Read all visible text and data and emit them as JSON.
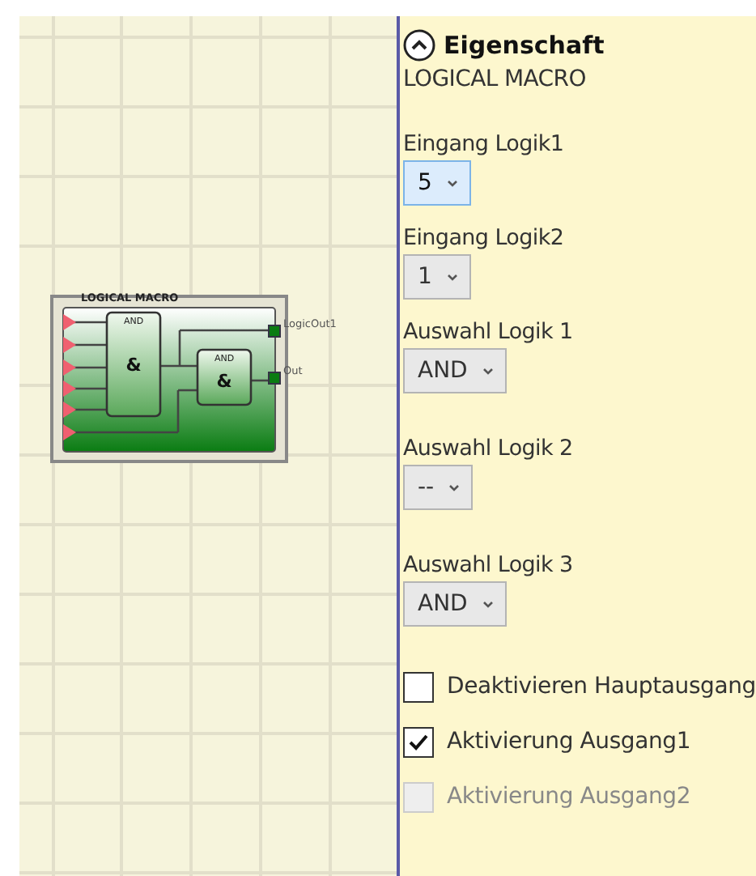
{
  "diagram": {
    "block": {
      "title": "LOGICAL MACRO",
      "gates": [
        {
          "label": "AND",
          "symbol": "&"
        },
        {
          "label": "AND",
          "symbol": "&"
        }
      ],
      "outputs": [
        "LogicOut1",
        "Out"
      ]
    }
  },
  "panel": {
    "header": {
      "title": "Eigenschaft",
      "expanded": true
    },
    "subtitle": "LOGICAL MACRO",
    "fields": [
      {
        "label": "Eingang Logik1",
        "value": "5",
        "focused": true
      },
      {
        "label": "Eingang Logik2",
        "value": "1",
        "focused": false
      },
      {
        "label": "Auswahl Logik 1",
        "value": "AND",
        "focused": false
      },
      {
        "label": "Auswahl Logik 2",
        "value": "--",
        "focused": false
      },
      {
        "label": "Auswahl Logik 3",
        "value": "AND",
        "focused": false
      }
    ],
    "checkboxes": [
      {
        "label": "Deaktivieren Hauptausgang",
        "checked": false,
        "disabled": false
      },
      {
        "label": "Aktivierung Ausgang1",
        "checked": true,
        "disabled": false
      },
      {
        "label": "Aktivierung Ausgang2",
        "checked": false,
        "disabled": true
      }
    ]
  }
}
